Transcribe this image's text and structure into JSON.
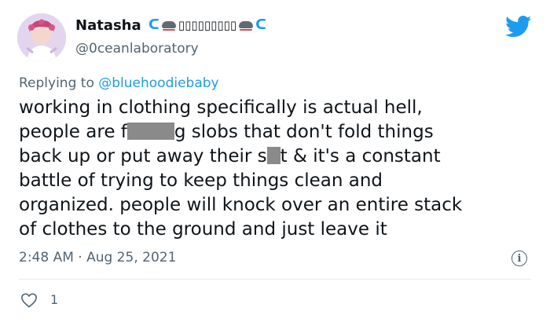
{
  "tweet": {
    "display_name": "Natasha",
    "name_decoration_boxes": "▯▯▯▯▯▯▯▯▯",
    "handle": "@0ceanlaboratory",
    "reply_prefix": "Replying to",
    "reply_to": "@bluehoodiebaby",
    "body": {
      "l1": "working in clothing specifically is actual hell,",
      "l2a": "people are f",
      "l2b": "g slobs that don't fold things",
      "l3a": "back up or put away their s",
      "l3b": "t & it's a constant",
      "l4": "battle of trying to keep things clean and",
      "l5": "organized. people will knock over an entire stack",
      "l6": "of clothes to the ground and just leave it"
    },
    "timestamp": "2:48 AM · Aug 25, 2021",
    "like_count": "1"
  },
  "colors": {
    "accent": "#1d9bf0",
    "secondary_text": "#536471",
    "primary_text": "#0f1419",
    "censor_block": "#8a8a8a"
  },
  "icons": {
    "brand": "twitter-bird-icon",
    "info": "info-icon",
    "like": "heart-icon"
  }
}
